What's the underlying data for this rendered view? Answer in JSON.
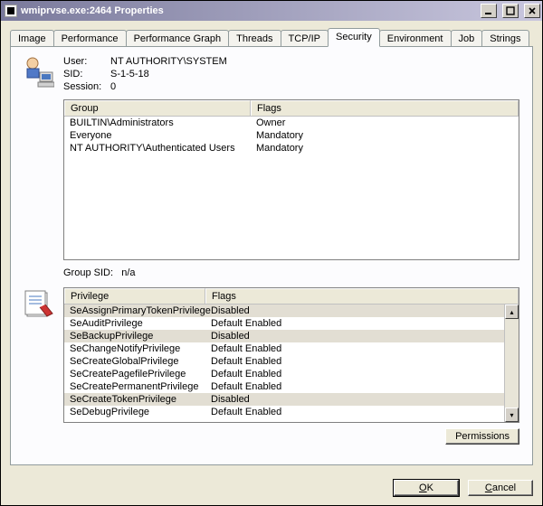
{
  "window": {
    "title": "wmiprvse.exe:2464 Properties"
  },
  "tabs": [
    {
      "label": "Image"
    },
    {
      "label": "Performance"
    },
    {
      "label": "Performance Graph"
    },
    {
      "label": "Threads"
    },
    {
      "label": "TCP/IP"
    },
    {
      "label": "Security"
    },
    {
      "label": "Environment"
    },
    {
      "label": "Job"
    },
    {
      "label": "Strings"
    }
  ],
  "active_tab": 5,
  "security": {
    "user_label": "User:",
    "user_value": "NT AUTHORITY\\SYSTEM",
    "sid_label": "SID:",
    "sid_value": "S-1-5-18",
    "session_label": "Session:",
    "session_value": "0",
    "groups_headers": {
      "c1": "Group",
      "c2": "Flags"
    },
    "groups": [
      {
        "name": "BUILTIN\\Administrators",
        "flags": "Owner"
      },
      {
        "name": "Everyone",
        "flags": "Mandatory"
      },
      {
        "name": "NT AUTHORITY\\Authenticated Users",
        "flags": "Mandatory"
      }
    ],
    "group_sid_label": "Group SID:",
    "group_sid_value": "n/a",
    "priv_headers": {
      "c1": "Privilege",
      "c2": "Flags"
    },
    "privileges": [
      {
        "name": "SeAssignPrimaryTokenPrivilege",
        "flags": "Disabled",
        "disabled": true
      },
      {
        "name": "SeAuditPrivilege",
        "flags": "Default Enabled",
        "disabled": false
      },
      {
        "name": "SeBackupPrivilege",
        "flags": "Disabled",
        "disabled": true
      },
      {
        "name": "SeChangeNotifyPrivilege",
        "flags": "Default Enabled",
        "disabled": false
      },
      {
        "name": "SeCreateGlobalPrivilege",
        "flags": "Default Enabled",
        "disabled": false
      },
      {
        "name": "SeCreatePagefilePrivilege",
        "flags": "Default Enabled",
        "disabled": false
      },
      {
        "name": "SeCreatePermanentPrivilege",
        "flags": "Default Enabled",
        "disabled": false
      },
      {
        "name": "SeCreateTokenPrivilege",
        "flags": "Disabled",
        "disabled": true
      },
      {
        "name": "SeDebugPrivilege",
        "flags": "Default Enabled",
        "disabled": false
      }
    ],
    "permissions_btn": "Permissions"
  },
  "dialog_buttons": {
    "ok": "OK",
    "cancel": "Cancel"
  }
}
